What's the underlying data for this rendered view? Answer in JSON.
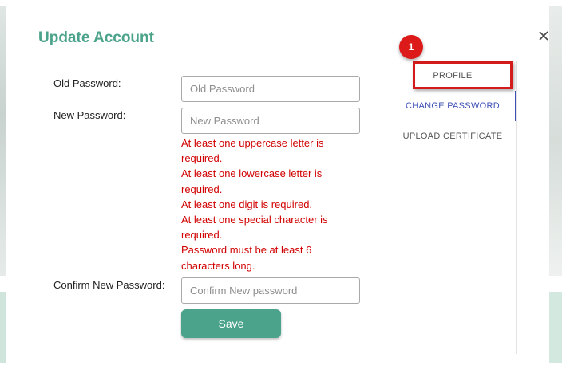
{
  "modal": {
    "title": "Update Account"
  },
  "form": {
    "old_password": {
      "label": "Old Password:",
      "placeholder": "Old Password",
      "value": ""
    },
    "new_password": {
      "label": "New Password:",
      "placeholder": "New Password",
      "value": ""
    },
    "confirm_password": {
      "label": "Confirm New Password:",
      "placeholder": "Confirm New password",
      "value": ""
    },
    "errors": [
      "At least one uppercase letter is required.",
      "At least one lowercase letter is required.",
      "At least one digit is required.",
      "At least one special character is required.",
      "Password must be at least 6 characters long."
    ],
    "save_label": "Save"
  },
  "tabs": [
    {
      "label": "PROFILE",
      "active": false
    },
    {
      "label": "CHANGE PASSWORD",
      "active": true
    },
    {
      "label": "UPLOAD CERTIFICATE",
      "active": false
    }
  ],
  "annotation": {
    "step_number": "1",
    "color": "#d31b1b"
  },
  "colors": {
    "title": "#4aa38a",
    "save_button": "#4aa38a",
    "active_tab": "#3f51b5",
    "error_text": "#d10000"
  },
  "icons": {
    "close": "close-icon"
  }
}
